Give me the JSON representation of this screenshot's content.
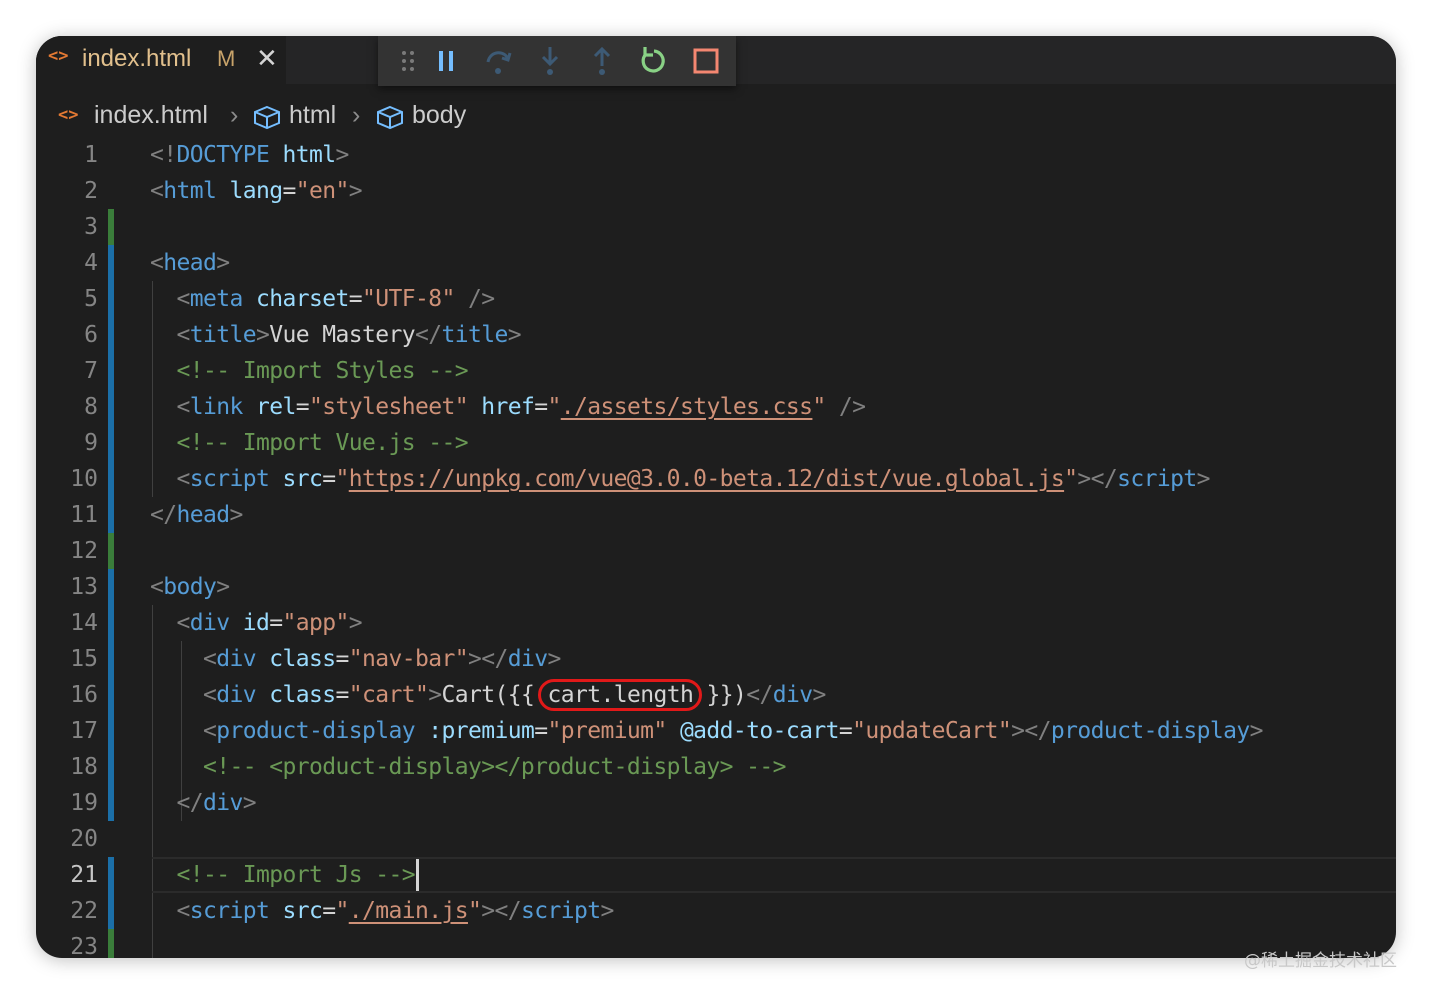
{
  "tab": {
    "icon": "html-file-icon",
    "icon_glyph": "<>",
    "filename": "index.html",
    "modified_flag": "M",
    "close_glyph": "✕"
  },
  "debug_toolbar": {
    "buttons": [
      {
        "name": "drag-handle-icon",
        "enabled": true
      },
      {
        "name": "pause-icon",
        "enabled": true
      },
      {
        "name": "step-over-icon",
        "enabled": false
      },
      {
        "name": "step-into-icon",
        "enabled": false
      },
      {
        "name": "step-out-icon",
        "enabled": false
      },
      {
        "name": "restart-icon",
        "enabled": true
      },
      {
        "name": "stop-icon",
        "enabled": true
      }
    ]
  },
  "breadcrumb": {
    "file": "index.html",
    "items": [
      "html",
      "body"
    ],
    "separator": "›"
  },
  "editor": {
    "active_line": 21,
    "lines": [
      {
        "n": "1",
        "tokens": [
          [
            "br",
            "<!"
          ],
          [
            "tag",
            "DOCTYPE"
          ],
          [
            "txt",
            " "
          ],
          [
            "attr",
            "html"
          ],
          [
            "br",
            ">"
          ]
        ]
      },
      {
        "n": "2",
        "tokens": [
          [
            "br",
            "<"
          ],
          [
            "tag",
            "html"
          ],
          [
            "txt",
            " "
          ],
          [
            "attr",
            "lang"
          ],
          [
            "txt",
            "="
          ],
          [
            "str",
            "\"en\""
          ],
          [
            "br",
            ">"
          ]
        ]
      },
      {
        "n": "3",
        "tokens": []
      },
      {
        "n": "4",
        "tokens": [
          [
            "br",
            "<"
          ],
          [
            "tag",
            "head"
          ],
          [
            "br",
            ">"
          ]
        ]
      },
      {
        "n": "5",
        "tokens": [
          [
            "txt",
            "  "
          ],
          [
            "br",
            "<"
          ],
          [
            "tag",
            "meta"
          ],
          [
            "txt",
            " "
          ],
          [
            "attr",
            "charset"
          ],
          [
            "txt",
            "="
          ],
          [
            "str",
            "\"UTF-8\""
          ],
          [
            "txt",
            " "
          ],
          [
            "br",
            "/>"
          ]
        ]
      },
      {
        "n": "6",
        "tokens": [
          [
            "txt",
            "  "
          ],
          [
            "br",
            "<"
          ],
          [
            "tag",
            "title"
          ],
          [
            "br",
            ">"
          ],
          [
            "txt",
            "Vue Mastery"
          ],
          [
            "br",
            "</"
          ],
          [
            "tag",
            "title"
          ],
          [
            "br",
            ">"
          ]
        ]
      },
      {
        "n": "7",
        "tokens": [
          [
            "txt",
            "  "
          ],
          [
            "com",
            "<!-- Import Styles -->"
          ]
        ]
      },
      {
        "n": "8",
        "tokens": [
          [
            "txt",
            "  "
          ],
          [
            "br",
            "<"
          ],
          [
            "tag",
            "link"
          ],
          [
            "txt",
            " "
          ],
          [
            "attr",
            "rel"
          ],
          [
            "txt",
            "="
          ],
          [
            "str",
            "\"stylesheet\""
          ],
          [
            "txt",
            " "
          ],
          [
            "attr",
            "href"
          ],
          [
            "txt",
            "="
          ],
          [
            "str",
            "\""
          ],
          [
            "link",
            "./assets/styles.css"
          ],
          [
            "str",
            "\""
          ],
          [
            "txt",
            " "
          ],
          [
            "br",
            "/>"
          ]
        ]
      },
      {
        "n": "9",
        "tokens": [
          [
            "txt",
            "  "
          ],
          [
            "com",
            "<!-- Import Vue.js -->"
          ]
        ]
      },
      {
        "n": "10",
        "tokens": [
          [
            "txt",
            "  "
          ],
          [
            "br",
            "<"
          ],
          [
            "tag",
            "script"
          ],
          [
            "txt",
            " "
          ],
          [
            "attr",
            "src"
          ],
          [
            "txt",
            "="
          ],
          [
            "str",
            "\""
          ],
          [
            "link",
            "https://unpkg.com/vue@3.0.0-beta.12/dist/vue.global.js"
          ],
          [
            "str",
            "\""
          ],
          [
            "br",
            "></"
          ],
          [
            "tag",
            "script"
          ],
          [
            "br",
            ">"
          ]
        ]
      },
      {
        "n": "11",
        "tokens": [
          [
            "br",
            "</"
          ],
          [
            "tag",
            "head"
          ],
          [
            "br",
            ">"
          ]
        ]
      },
      {
        "n": "12",
        "tokens": []
      },
      {
        "n": "13",
        "tokens": [
          [
            "br",
            "<"
          ],
          [
            "tag",
            "body"
          ],
          [
            "br",
            ">"
          ]
        ]
      },
      {
        "n": "14",
        "tokens": [
          [
            "txt",
            "  "
          ],
          [
            "br",
            "<"
          ],
          [
            "tag",
            "div"
          ],
          [
            "txt",
            " "
          ],
          [
            "attr",
            "id"
          ],
          [
            "txt",
            "="
          ],
          [
            "str",
            "\"app\""
          ],
          [
            "br",
            ">"
          ]
        ]
      },
      {
        "n": "15",
        "tokens": [
          [
            "txt",
            "    "
          ],
          [
            "br",
            "<"
          ],
          [
            "tag",
            "div"
          ],
          [
            "txt",
            " "
          ],
          [
            "attr",
            "class"
          ],
          [
            "txt",
            "="
          ],
          [
            "str",
            "\"nav-bar\""
          ],
          [
            "br",
            "></"
          ],
          [
            "tag",
            "div"
          ],
          [
            "br",
            ">"
          ]
        ]
      },
      {
        "n": "16",
        "tokens": [
          [
            "txt",
            "    "
          ],
          [
            "br",
            "<"
          ],
          [
            "tag",
            "div"
          ],
          [
            "txt",
            " "
          ],
          [
            "attr",
            "class"
          ],
          [
            "txt",
            "="
          ],
          [
            "str",
            "\"cart\""
          ],
          [
            "br",
            ">"
          ],
          [
            "txt",
            "Cart({{ "
          ],
          [
            "hl",
            "cart.length"
          ],
          [
            "txt",
            " }})"
          ],
          [
            "br",
            "</"
          ],
          [
            "tag",
            "div"
          ],
          [
            "br",
            ">"
          ]
        ]
      },
      {
        "n": "17",
        "tokens": [
          [
            "txt",
            "    "
          ],
          [
            "br",
            "<"
          ],
          [
            "tag",
            "product-display"
          ],
          [
            "txt",
            " "
          ],
          [
            "attr",
            ":premium"
          ],
          [
            "txt",
            "="
          ],
          [
            "str",
            "\"premium\""
          ],
          [
            "txt",
            " "
          ],
          [
            "attr",
            "@add-to-cart"
          ],
          [
            "txt",
            "="
          ],
          [
            "str",
            "\"updateCart\""
          ],
          [
            "br",
            "></"
          ],
          [
            "tag",
            "product-display"
          ],
          [
            "br",
            ">"
          ]
        ]
      },
      {
        "n": "18",
        "tokens": [
          [
            "txt",
            "    "
          ],
          [
            "com",
            "<!-- <product-display></product-display> -->"
          ]
        ]
      },
      {
        "n": "19",
        "tokens": [
          [
            "txt",
            "  "
          ],
          [
            "br",
            "</"
          ],
          [
            "tag",
            "div"
          ],
          [
            "br",
            ">"
          ]
        ]
      },
      {
        "n": "20",
        "tokens": []
      },
      {
        "n": "21",
        "tokens": [
          [
            "txt",
            "  "
          ],
          [
            "com",
            "<!-- Import Js -->"
          ]
        ]
      },
      {
        "n": "22",
        "tokens": [
          [
            "txt",
            "  "
          ],
          [
            "br",
            "<"
          ],
          [
            "tag",
            "script"
          ],
          [
            "txt",
            " "
          ],
          [
            "attr",
            "src"
          ],
          [
            "txt",
            "="
          ],
          [
            "str",
            "\""
          ],
          [
            "link",
            "./main.js"
          ],
          [
            "str",
            "\""
          ],
          [
            "br",
            "></"
          ],
          [
            "tag",
            "script"
          ],
          [
            "br",
            ">"
          ]
        ]
      },
      {
        "n": "23",
        "tokens": []
      }
    ]
  },
  "gutter_marks": {
    "3": "#3a7d3a",
    "4": "#1b6fa8",
    "5": "#1b6fa8",
    "6": "#1b6fa8",
    "7": "#1b6fa8",
    "8": "#1b6fa8",
    "9": "#1b6fa8",
    "10": "#1b6fa8",
    "11": "#1b6fa8",
    "12": "#3a7d3a",
    "13": "#1b6fa8",
    "14": "#1b6fa8",
    "15": "#1b6fa8",
    "16": "#1b6fa8",
    "17": "#1b6fa8",
    "18": "#1b6fa8",
    "19": "#1b6fa8",
    "21": "#1b6fa8",
    "22": "#1b6fa8",
    "23": "#3a7d3a"
  },
  "highlight_color": "#e11919",
  "watermark": "@稀土掘金技术社区"
}
